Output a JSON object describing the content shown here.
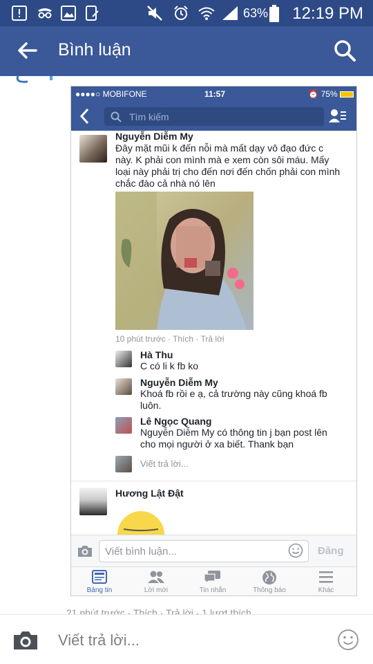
{
  "android_status": {
    "battery_pct": "63%",
    "time": "12:19 PM"
  },
  "app_bar": {
    "title": "Bình luận"
  },
  "shot": {
    "status": {
      "carrier": "●●●●○ MOBIFONE",
      "time": "11:57",
      "battery": "75%"
    },
    "search_placeholder": "Tìm kiếm",
    "comment": {
      "author": "Nguyễn Diễm My",
      "lines": [
        "Đây mặt mũi k đến nỗi mà mất dạy vô đạo đức c",
        "này. K phải con mình mà e xem còn sôi máu. Mấy",
        "loại này phải trị cho đến nơi đến chốn phải con mình",
        "chắc đào cả nhà nó lên"
      ],
      "meta": "10 phút trước · Thích · Trả lời"
    },
    "replies": [
      {
        "author": "Hà Thu",
        "lines": [
          "C có li k fb ko"
        ]
      },
      {
        "author": "Nguyễn Diễm My",
        "lines": [
          "Khoá fb rồi e ạ, cả trường này cũng khoá fb",
          "luôn."
        ]
      },
      {
        "author": "Lê Ngọc Quang",
        "lines": [
          "Nguyễn Diễm My  có thông tin j bạn post lên",
          "cho mọi người ở xa biết. Thank bạn"
        ]
      }
    ],
    "reply_placeholder": "Viết trả lời...",
    "second_author": "Hương Lật Đật",
    "composer": {
      "placeholder": "Viết bình luận...",
      "post": "Đăng"
    },
    "tabs": [
      {
        "label": "Bảng tin",
        "icon": "news-feed-icon",
        "active": true
      },
      {
        "label": "Lời mời",
        "icon": "friend-requests-icon",
        "active": false
      },
      {
        "label": "Tin nhắn",
        "icon": "messages-icon",
        "active": false
      },
      {
        "label": "Thông báo",
        "icon": "globe-icon",
        "active": false
      },
      {
        "label": "Khác",
        "icon": "menu-icon",
        "active": false
      }
    ]
  },
  "below_meta": "21 phút trước · Thích · Trả lời · 1 lượt thích",
  "reply_bar": {
    "placeholder": "Viết trả lời..."
  },
  "colors": {
    "brand": "#3b5998",
    "status_bar": "#2d4a86",
    "link": "#4267b2"
  }
}
